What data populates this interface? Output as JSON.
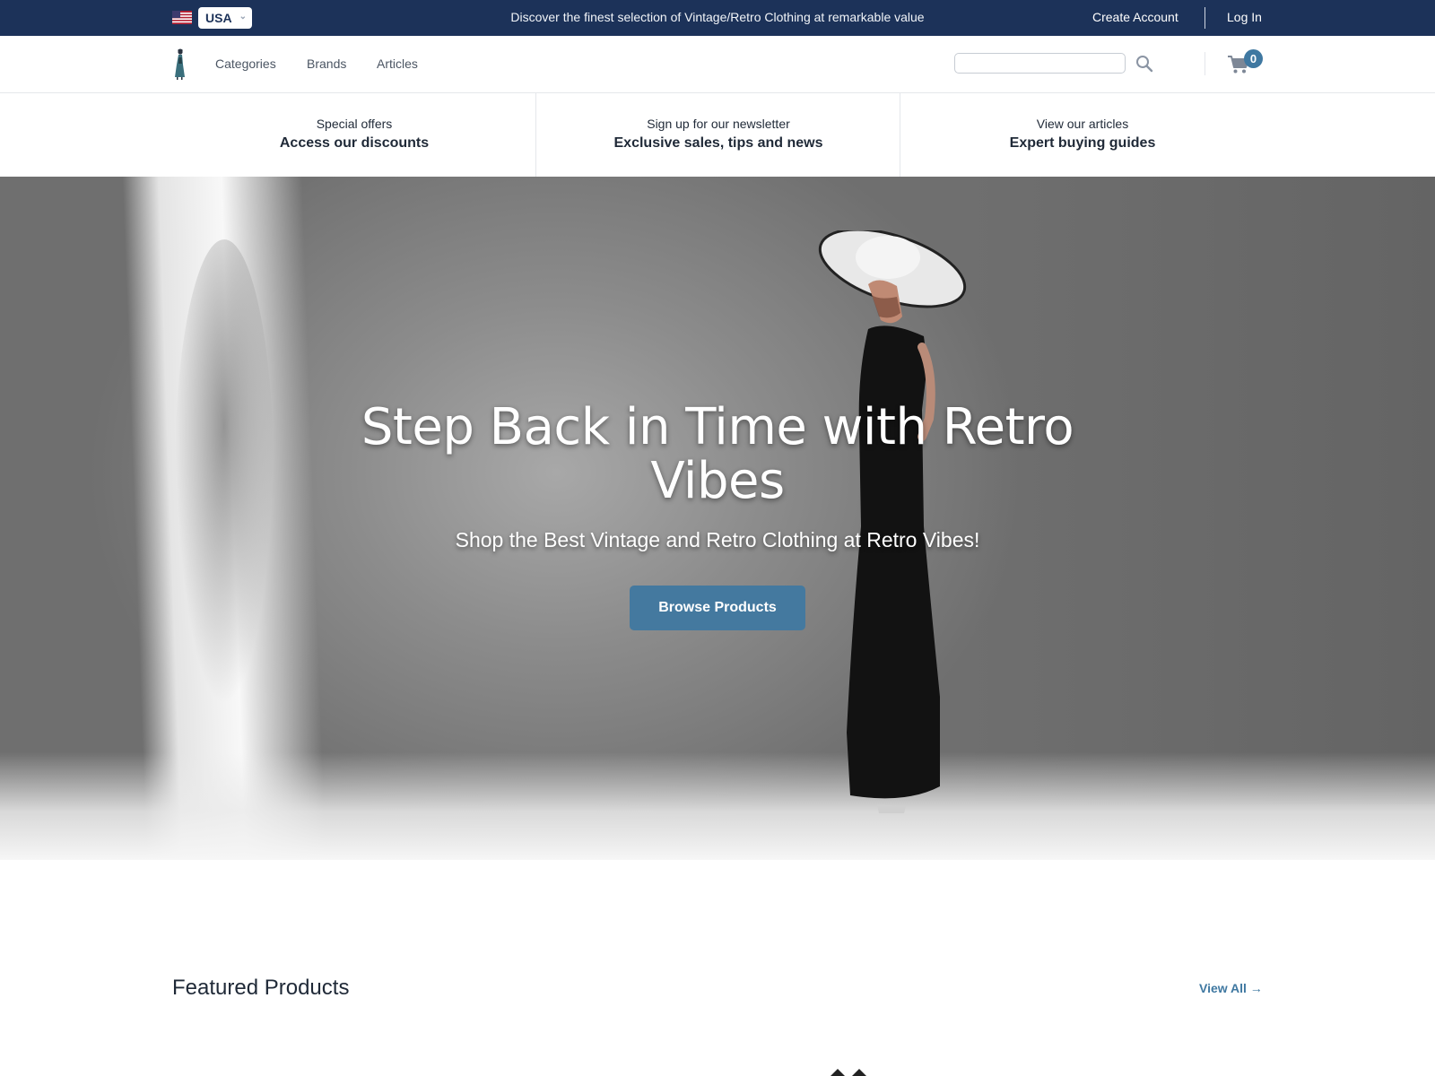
{
  "topbar": {
    "country": "USA",
    "announcement": "Discover the finest selection of Vintage/Retro Clothing at remarkable value",
    "create_account": "Create Account",
    "log_in": "Log In"
  },
  "nav": {
    "links": [
      "Categories",
      "Brands",
      "Articles"
    ],
    "search_placeholder": "",
    "cart_count": "0"
  },
  "promos": [
    {
      "small": "Special offers",
      "big": "Access our discounts"
    },
    {
      "small": "Sign up for our newsletter",
      "big": "Exclusive sales, tips and news"
    },
    {
      "small": "View our articles",
      "big": "Expert buying guides"
    }
  ],
  "hero": {
    "title": "Step Back in Time with Retro Vibes",
    "subtitle": "Shop the Best Vintage and Retro Clothing at Retro Vibes!",
    "cta": "Browse Products"
  },
  "featured": {
    "title": "Featured Products",
    "view_all": "View All →"
  },
  "colors": {
    "topbar": "#1c3259",
    "accent": "#3f78a1",
    "button": "#44799f"
  },
  "icons": [
    "us-flag-icon",
    "chevron-down-icon",
    "logo-icon",
    "search-icon",
    "cart-icon"
  ]
}
